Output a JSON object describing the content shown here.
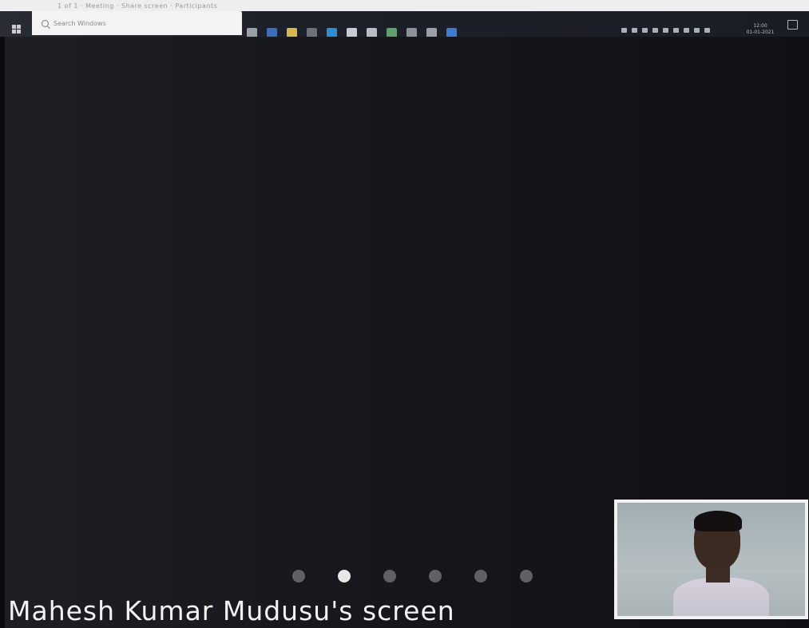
{
  "top_strip": {
    "text": "1 of 1 · Meeting · Share screen · Participants"
  },
  "taskbar": {
    "search_placeholder": "Search Windows",
    "apps": [
      {
        "icon": "task-view-icon",
        "color": "#9aa0a8"
      },
      {
        "icon": "edge-icon",
        "color": "#3b6fb6"
      },
      {
        "icon": "file-explorer-icon",
        "color": "#d9b84a"
      },
      {
        "icon": "store-icon",
        "color": "#6d7278"
      },
      {
        "icon": "mail-icon",
        "color": "#2c8fd6"
      },
      {
        "icon": "dropbox-icon",
        "color": "#c7ccd4"
      },
      {
        "icon": "camera-icon",
        "color": "#b9bec6"
      },
      {
        "icon": "chrome-icon",
        "color": "#5f9e6e"
      },
      {
        "icon": "notes-icon",
        "color": "#8c9199"
      },
      {
        "icon": "search-app-icon",
        "color": "#9aa0a8"
      },
      {
        "icon": "teams-icon",
        "color": "#3a7bd5"
      }
    ],
    "tray_icons": [
      "network-icon",
      "volume-icon",
      "battery-icon",
      "language-icon",
      "wifi-icon",
      "onedrive-icon",
      "security-icon",
      "bluetooth-icon",
      "update-icon"
    ],
    "clock": {
      "time": "12:00",
      "date": "01-01-2021"
    }
  },
  "pager": {
    "count": 6,
    "active_index": 1
  },
  "presenter_label": "Mahesh Kumar Mudusu's screen",
  "video": {
    "participant_name": ""
  }
}
